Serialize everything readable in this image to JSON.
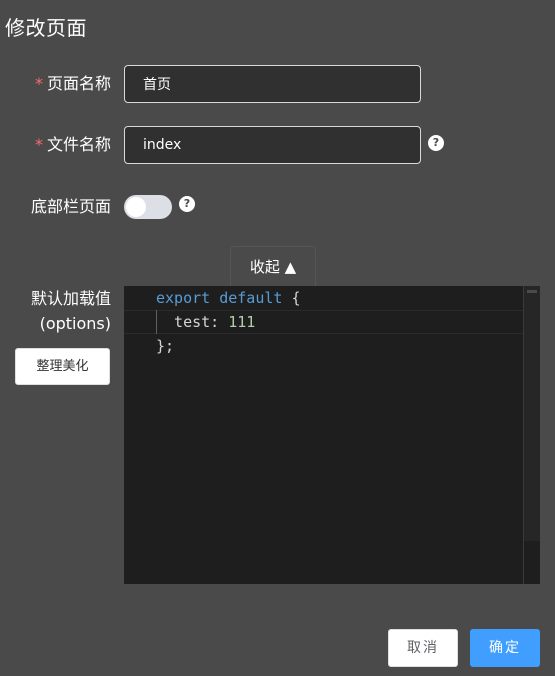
{
  "dialog": {
    "title": "修改页面"
  },
  "form": {
    "page_name": {
      "required_mark": "*",
      "label": "页面名称",
      "value": "首页"
    },
    "file_name": {
      "required_mark": "*",
      "label": "文件名称",
      "value": "index",
      "help_icon": "question-circle-icon",
      "help_glyph": "?"
    },
    "footer_page": {
      "label": "底部栏页面",
      "enabled": false,
      "help_icon": "question-circle-icon",
      "help_glyph": "?"
    },
    "collapse": {
      "label": "收起 ▲"
    },
    "default_data": {
      "label_line1": "默认加载值",
      "label_line2": "(options)",
      "format_button": "整理美化",
      "code": {
        "line1_keyword": "export default",
        "line1_brace": " {",
        "line2_key": "  test: ",
        "line2_value": "111",
        "line3": "};"
      }
    }
  },
  "footer": {
    "cancel_label": "取消",
    "ok_label": "确定"
  },
  "colors": {
    "background": "#4a4a4a",
    "required": "#f56c6c",
    "primary": "#409eff",
    "editor_bg": "#1e1e1e",
    "keyword": "#569cd6",
    "number": "#b5cea8"
  }
}
